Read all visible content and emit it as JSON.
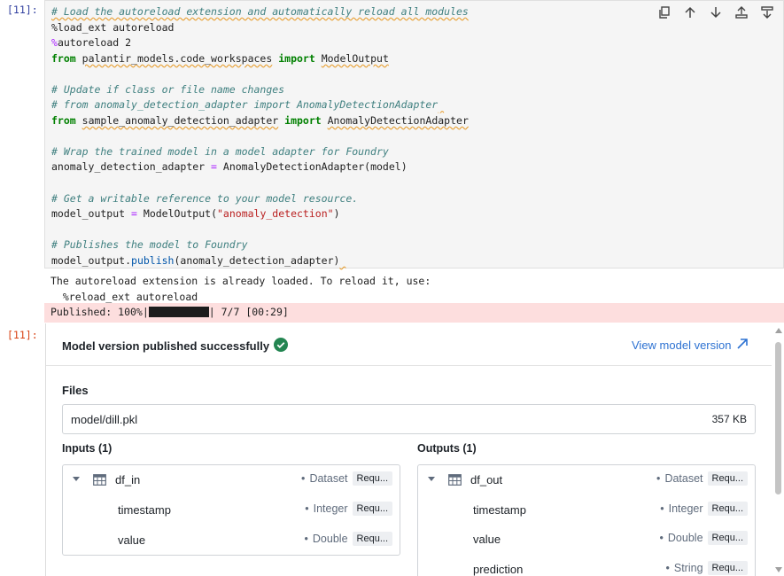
{
  "cell": {
    "input_prompt": "[11]:",
    "output_prompt": "[11]:"
  },
  "code": {
    "l1": "# Load the autoreload extension and automatically reload all modules",
    "l2": "%load_ext autoreload",
    "l3_magic": "%",
    "l3_rest": "autoreload 2",
    "l4_from": "from",
    "l4_module": "palantir_models.code_workspaces",
    "l4_import": "import",
    "l4_name": "ModelOutput",
    "l6": "# Update if class or file name changes",
    "l7": "# from anomaly_detection_adapter import AnomalyDetectionAdapter",
    "l8_from": "from",
    "l8_module": "sample_anomaly_detection_adapter",
    "l8_import": "import",
    "l8_name": "AnomalyDetectionAdapter",
    "l10": "# Wrap the trained model in a model adapter for Foundry",
    "l11_lhs": "anomaly_detection_adapter",
    "l11_op": "=",
    "l11_rhs": "AnomalyDetectionAdapter(model)",
    "l13": "# Get a writable reference to your model resource.",
    "l14_lhs": "model_output",
    "l14_op": "=",
    "l14_call": "ModelOutput(",
    "l14_str": "\"anomaly_detection\"",
    "l14_close": ")",
    "l16": "# Publishes the model to Foundry",
    "l17_obj": "model_output.",
    "l17_method": "publish",
    "l17_args": "(anomaly_detection_adapter)"
  },
  "toolbar": {
    "icons": [
      "copy-icon",
      "move-up-icon",
      "move-down-icon",
      "insert-above-icon",
      "insert-below-icon"
    ]
  },
  "stdout": {
    "line1": "The autoreload extension is already loaded. To reload it, use:",
    "line2": "  %reload_ext autoreload"
  },
  "stderr": {
    "prefix": "Published: 100%|",
    "progress": 1.0,
    "suffix": "| 7/7 [00:29]"
  },
  "publish": {
    "title": "Model version published successfully",
    "view_link": "View model version",
    "files_label": "Files",
    "file": {
      "name": "model/dill.pkl",
      "size": "357 KB"
    },
    "inputs_label": "Inputs (1)",
    "outputs_label": "Outputs (1)",
    "inputs": [
      {
        "name": "df_in",
        "kind": "Dataset",
        "req": "Requ...",
        "fields": [
          {
            "name": "timestamp",
            "type": "Integer",
            "req": "Requ..."
          },
          {
            "name": "value",
            "type": "Double",
            "req": "Requ..."
          }
        ]
      }
    ],
    "outputs": [
      {
        "name": "df_out",
        "kind": "Dataset",
        "req": "Requ...",
        "fields": [
          {
            "name": "timestamp",
            "type": "Integer",
            "req": "Requ..."
          },
          {
            "name": "value",
            "type": "Double",
            "req": "Requ..."
          },
          {
            "name": "prediction",
            "type": "String",
            "req": "Requ..."
          }
        ]
      }
    ]
  },
  "colors": {
    "success": "#238551",
    "link": "#2d72d2",
    "stderr_bg": "#fddede",
    "code_bg": "#f5f5f5"
  }
}
